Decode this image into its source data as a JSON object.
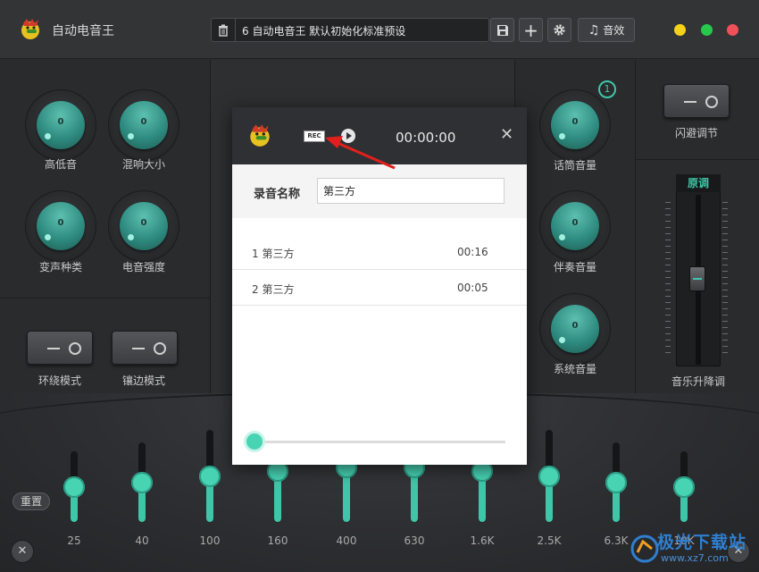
{
  "app": {
    "title": "自动电音王"
  },
  "toolbar": {
    "preset_text": "6 自动电音王 默认初始化标准预设",
    "sound_effect_label": "音效"
  },
  "window_controls": {
    "minimize_color": "#f5d21a",
    "maximize_color": "#26c94a",
    "close_color": "#f0505a"
  },
  "left_knobs": [
    {
      "label": "高低音",
      "value": "0"
    },
    {
      "label": "混响大小",
      "value": "0"
    },
    {
      "label": "变声种类",
      "value": "0"
    },
    {
      "label": "电音强度",
      "value": "0"
    }
  ],
  "left_toggles": [
    {
      "label": "环绕模式"
    },
    {
      "label": "镶边模式"
    }
  ],
  "right_knobs": [
    {
      "label": "话筒音量",
      "value": "0"
    },
    {
      "label": "伴奏音量",
      "value": "0"
    },
    {
      "label": "系统音量",
      "value": "0"
    }
  ],
  "badge": "1",
  "far_right": {
    "toggle_label": "闪避调节",
    "pitch_header": "原调",
    "pitch_label": "音乐升降调"
  },
  "eq": {
    "reset_label": "重置",
    "bands": [
      {
        "label": "25",
        "level": 0.5
      },
      {
        "label": "40",
        "level": 0.5
      },
      {
        "label": "100",
        "level": 0.5
      },
      {
        "label": "160",
        "level": 0.5
      },
      {
        "label": "400",
        "level": 0.5
      },
      {
        "label": "630",
        "level": 0.5
      },
      {
        "label": "1.6K",
        "level": 0.5
      },
      {
        "label": "2.5K",
        "level": 0.5
      },
      {
        "label": "6.3K",
        "level": 0.5
      },
      {
        "label": "10K",
        "level": 0.5
      }
    ]
  },
  "recorder": {
    "rec_label": "REC",
    "time": "00:00:00",
    "close_symbol": "✕",
    "name_label": "录音名称",
    "name_value": "第三方",
    "recordings": [
      {
        "name": "1 第三方",
        "duration": "00:16"
      },
      {
        "name": "2 第三方",
        "duration": "00:05"
      }
    ],
    "progress": 0
  },
  "watermark": {
    "text": "极光下载站",
    "url": "www.xz7.com"
  },
  "accent_color": "#3fc6a8"
}
